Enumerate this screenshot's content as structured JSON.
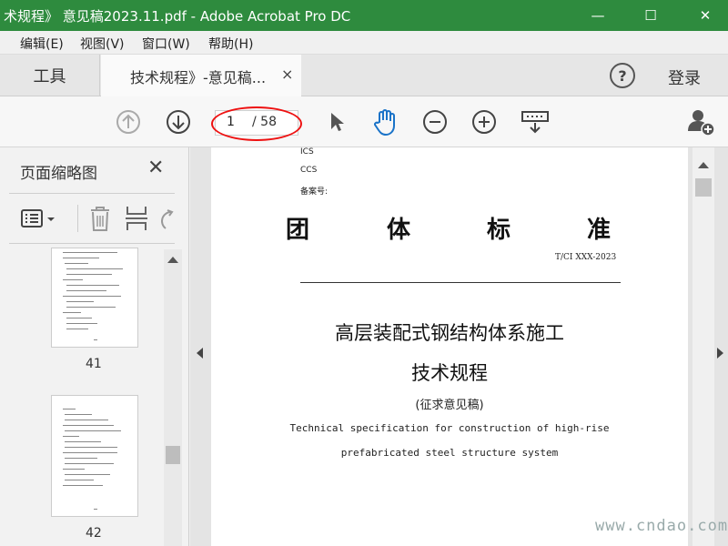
{
  "window": {
    "title": "术规程》 意见稿2023.11.pdf - Adobe Acrobat Pro DC",
    "minimize_glyph": "—",
    "maximize_glyph": "☐",
    "close_glyph": "✕"
  },
  "menu": {
    "items": [
      "编辑(E)",
      "视图(V)",
      "窗口(W)",
      "帮助(H)"
    ]
  },
  "tabs": {
    "tools_label": "工具",
    "doc_label": "技术规程》-意见稿...",
    "close_glyph": "×"
  },
  "header": {
    "help_glyph": "?",
    "login_label": "登录"
  },
  "toolbar": {
    "current_page": "1",
    "total_pages": "/ 58",
    "icons": [
      "prev-page-icon",
      "next-page-icon",
      "select-tool-icon",
      "hand-tool-icon",
      "zoom-out-icon",
      "zoom-in-icon",
      "keyboard-scroll-icon",
      "add-user-icon"
    ]
  },
  "panel": {
    "title": "页面缩略图",
    "close_glyph": "✕",
    "thumbnails": [
      {
        "page_number": "41"
      },
      {
        "page_number": "42"
      }
    ]
  },
  "document": {
    "ics": "ICS",
    "ccs": "CCS",
    "record_no": "备案号:",
    "big_title_chars": [
      "团",
      "体",
      "标",
      "准"
    ],
    "code": "T/CI XXX-2023",
    "title_line1": "高层装配式钢结构体系施工",
    "title_line2": "技术规程",
    "subtitle": "(征求意见稿)",
    "en_line1": "Technical specification for construction of high-rise",
    "en_line2": "prefabricated steel structure system"
  },
  "watermark": "www.cndao.com",
  "colors": {
    "titlebar": "#2e8b3e",
    "accent_blue": "#1a73c8",
    "highlight_red": "#e11111"
  }
}
